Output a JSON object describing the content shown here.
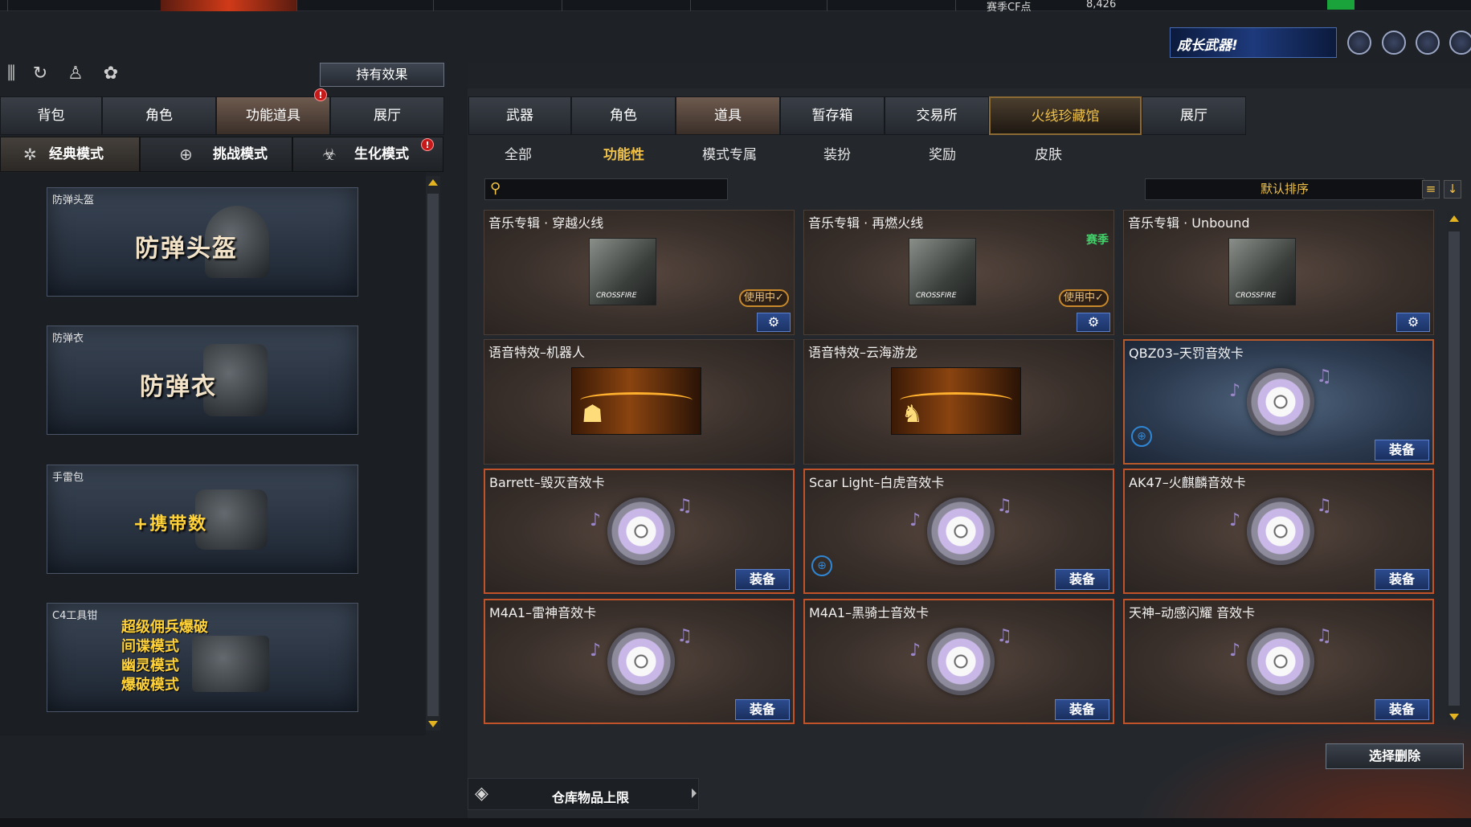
{
  "topbar": {
    "season_cf": "赛季CF点",
    "points": "8,426"
  },
  "header": {
    "grow_weapon": "成长武器!"
  },
  "left": {
    "hold_effect": "持有效果",
    "tabs": [
      "背包",
      "角色",
      "功能道具",
      "展厅"
    ],
    "modes": [
      "经典模式",
      "挑战模式",
      "生化模式"
    ],
    "items": [
      {
        "label": "防弹头盔",
        "big": "防弹头盔"
      },
      {
        "label": "防弹衣",
        "big": "防弹衣"
      },
      {
        "label": "手雷包",
        "big": "+携带数"
      },
      {
        "label": "C4工具钳",
        "lines": [
          "超级佣兵爆破",
          "间谍模式",
          "幽灵模式",
          "爆破模式"
        ]
      }
    ],
    "alert_glyph": "!"
  },
  "right": {
    "tabs": [
      "武器",
      "角色",
      "道具",
      "暂存箱",
      "交易所",
      "火线珍藏馆",
      "展厅"
    ],
    "subtabs": [
      "全部",
      "功能性",
      "模式专属",
      "装扮",
      "奖励",
      "皮肤"
    ],
    "sort_label": "默认排序",
    "equip_label": "装备",
    "using_label": "使用中✓",
    "season_label": "赛季",
    "cards": [
      {
        "title": "音乐专辑 · 穿越火线"
      },
      {
        "title": "音乐专辑 · 再燃火线"
      },
      {
        "title": "音乐专辑 · Unbound"
      },
      {
        "title": "语音特效–机器人"
      },
      {
        "title": "语音特效–云海游龙"
      },
      {
        "title": "QBZ03–天罚音效卡"
      },
      {
        "title": "Barrett–毁灭音效卡"
      },
      {
        "title": "Scar Light–白虎音效卡"
      },
      {
        "title": "AK47–火麒麟音效卡"
      },
      {
        "title": "M4A1–雷神音效卡"
      },
      {
        "title": "M4A1–黑骑士音效卡"
      },
      {
        "title": "天神–动感闪耀 音效卡"
      }
    ],
    "select_delete": "选择删除",
    "storage_limit": "仓库物品上限"
  },
  "album_logo": "CROSSFIRE"
}
